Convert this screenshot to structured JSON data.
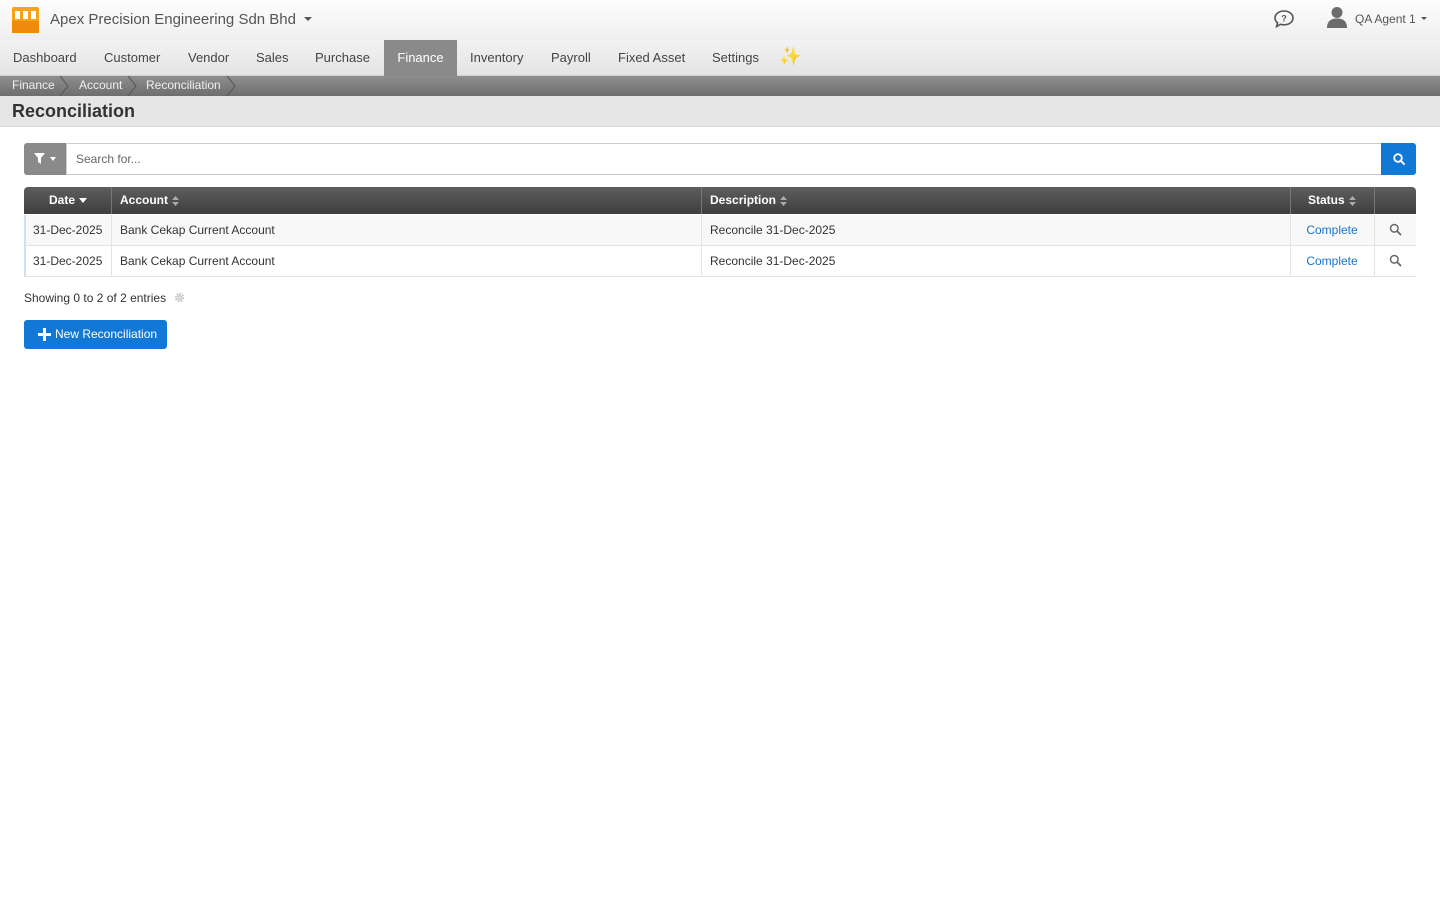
{
  "header": {
    "company_name": "Apex Precision Engineering Sdn Bhd",
    "user_name": "QA Agent 1",
    "icons": [
      "logo-icon",
      "chat-icon",
      "user-icon"
    ]
  },
  "nav": {
    "items": [
      {
        "label": "Dashboard"
      },
      {
        "label": "Customer"
      },
      {
        "label": "Vendor"
      },
      {
        "label": "Sales"
      },
      {
        "label": "Purchase"
      },
      {
        "label": "Finance",
        "active": true
      },
      {
        "label": "Inventory"
      },
      {
        "label": "Payroll"
      },
      {
        "label": "Fixed Asset"
      },
      {
        "label": "Settings"
      }
    ],
    "sparkle": "✨"
  },
  "breadcrumb": [
    "Finance",
    "Account",
    "Reconciliation"
  ],
  "page": {
    "title": "Reconciliation"
  },
  "search": {
    "placeholder": "Search for..."
  },
  "table": {
    "columns": [
      "Date",
      "Account",
      "Description",
      "Status"
    ],
    "sorted_column": "Date",
    "rows": [
      {
        "date": "31-Dec-2025",
        "account": "Bank Cekap Current Account",
        "description": "Reconcile 31-Dec-2025",
        "status": "Complete"
      },
      {
        "date": "31-Dec-2025",
        "account": "Bank Cekap Current Account",
        "description": "Reconcile 31-Dec-2025",
        "status": "Complete"
      }
    ]
  },
  "footer": {
    "entries_info": "Showing 0 to 2 of 2 entries",
    "new_button_label": "New Reconciliation"
  },
  "colors": {
    "primary": "#1178d6",
    "link": "#1a73c9",
    "nav_active": "#8a8a8a",
    "table_header": "#4a4a4a"
  }
}
